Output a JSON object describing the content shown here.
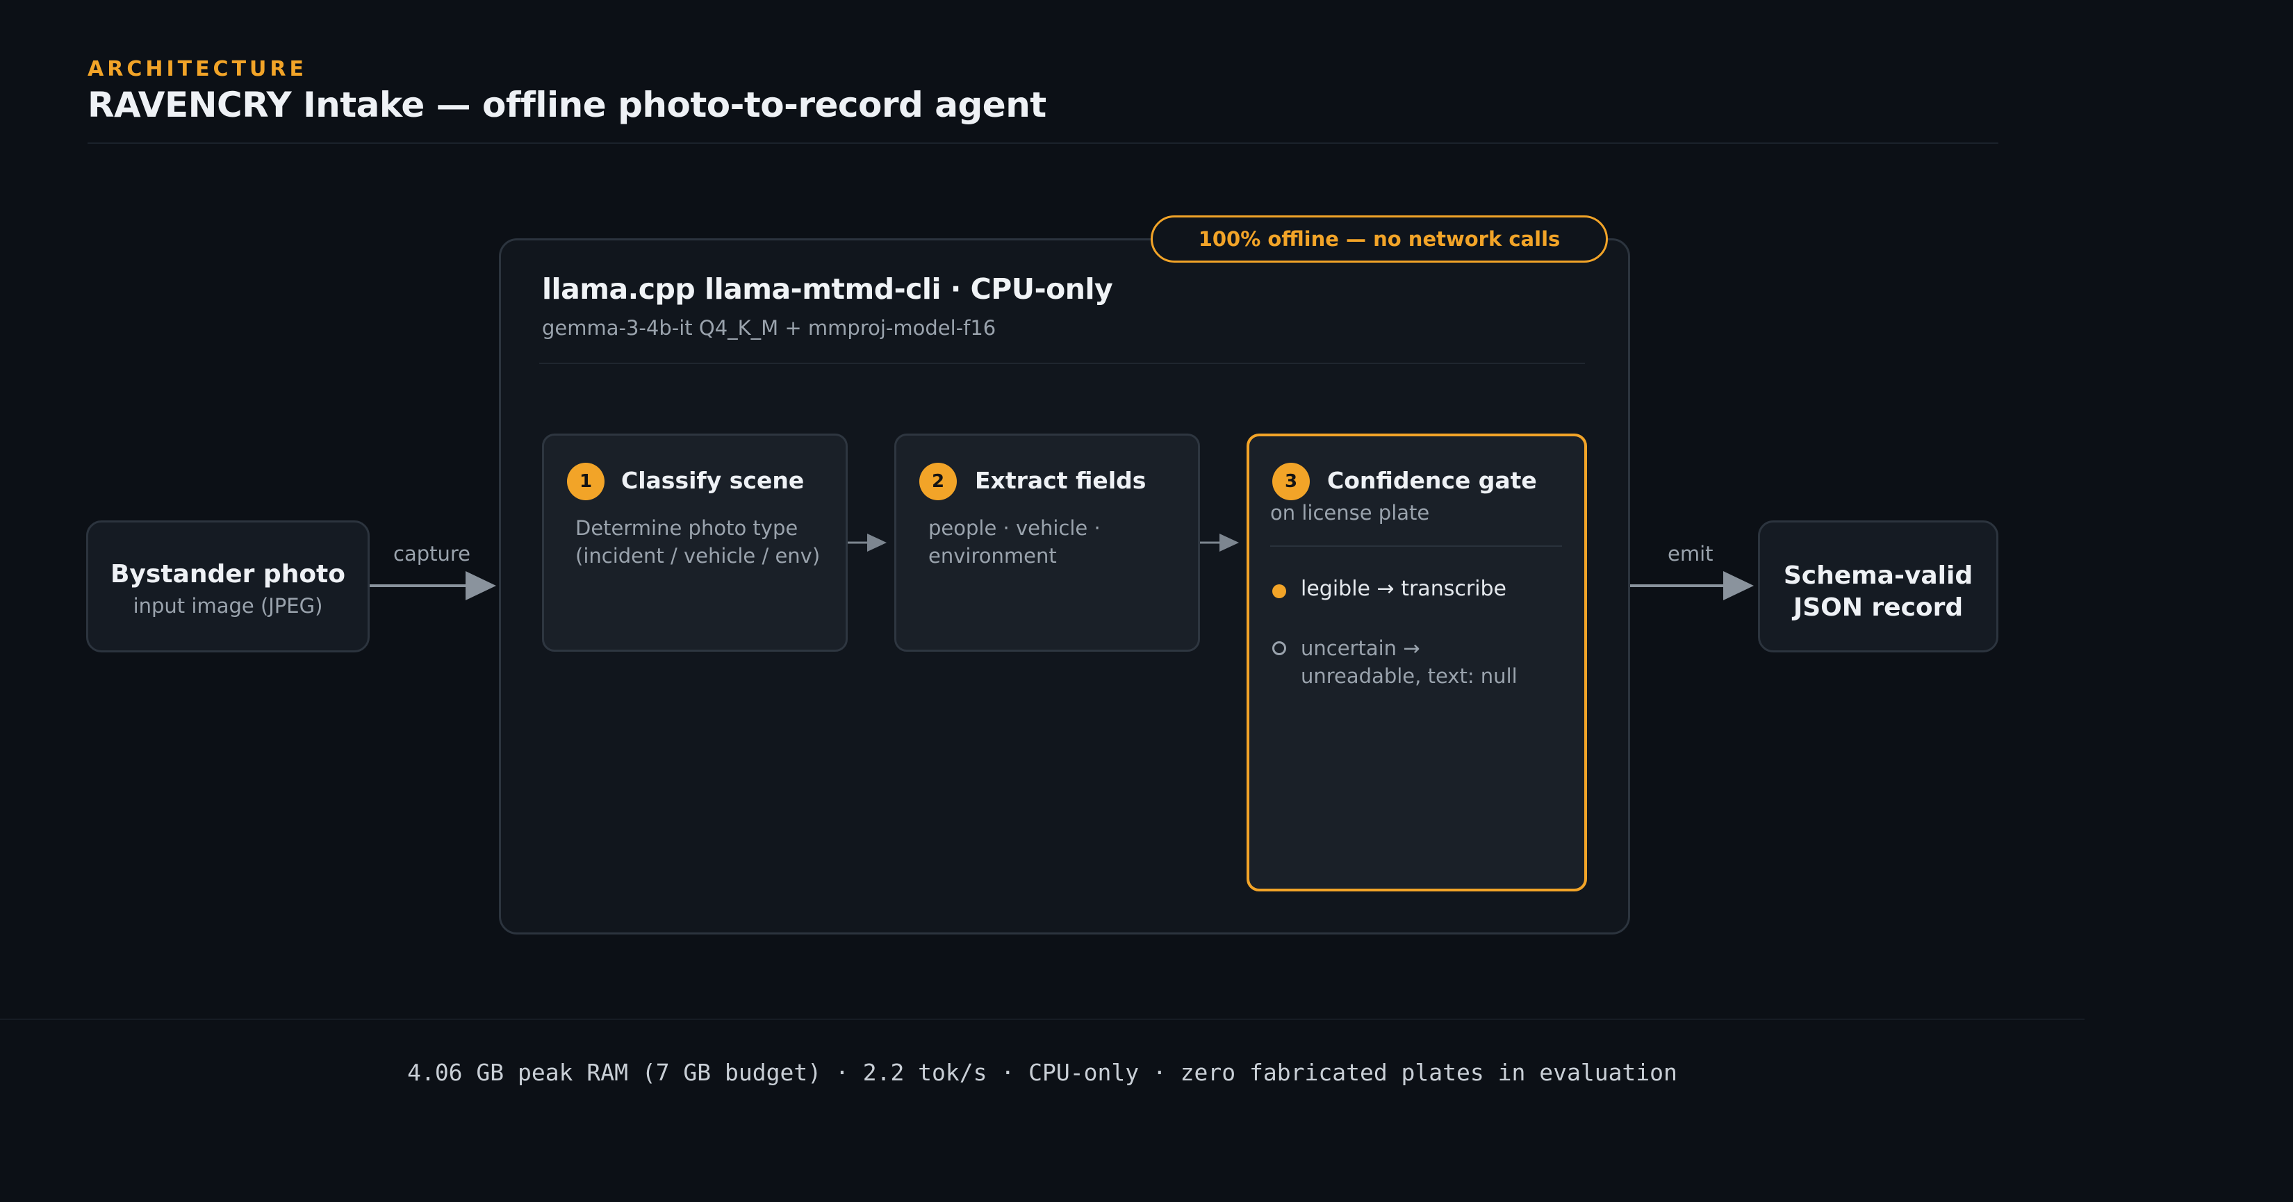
{
  "header": {
    "eyebrow": "ARCHITECTURE",
    "title": "RAVENCRY Intake — offline photo-to-record agent"
  },
  "input_node": {
    "title": "Bystander photo",
    "subtitle": "input image (JPEG)"
  },
  "output_node": {
    "title_line1": "Schema-valid",
    "title_line2": "JSON record"
  },
  "edges": {
    "capture": "capture",
    "emit": "emit"
  },
  "runtime": {
    "badge": "100% offline — no network calls",
    "title": "llama.cpp llama-mtmd-cli · CPU-only",
    "subtitle": "gemma-3-4b-it Q4_K_M + mmproj-model-f16"
  },
  "stages": [
    {
      "number": "1",
      "title": "Classify scene",
      "desc_line1": "Determine photo type",
      "desc_line2": "(incident / vehicle / env)"
    },
    {
      "number": "2",
      "title": "Extract fields",
      "desc_line1": "people · vehicle ·",
      "desc_line2": "environment"
    },
    {
      "number": "3",
      "title": "Confidence gate",
      "subtitle": "on license plate",
      "option_legible": "legible → transcribe",
      "option_uncertain_line1": "uncertain →",
      "option_uncertain_line2": "unreadable, text: null"
    }
  ],
  "footer": "4.06 GB peak RAM (7 GB budget) · 2.2 tok/s · CPU-only · zero fabricated plates in evaluation",
  "colors": {
    "accent": "#f2a428",
    "background": "#0c1016",
    "muted_text": "#9aa3ad"
  }
}
